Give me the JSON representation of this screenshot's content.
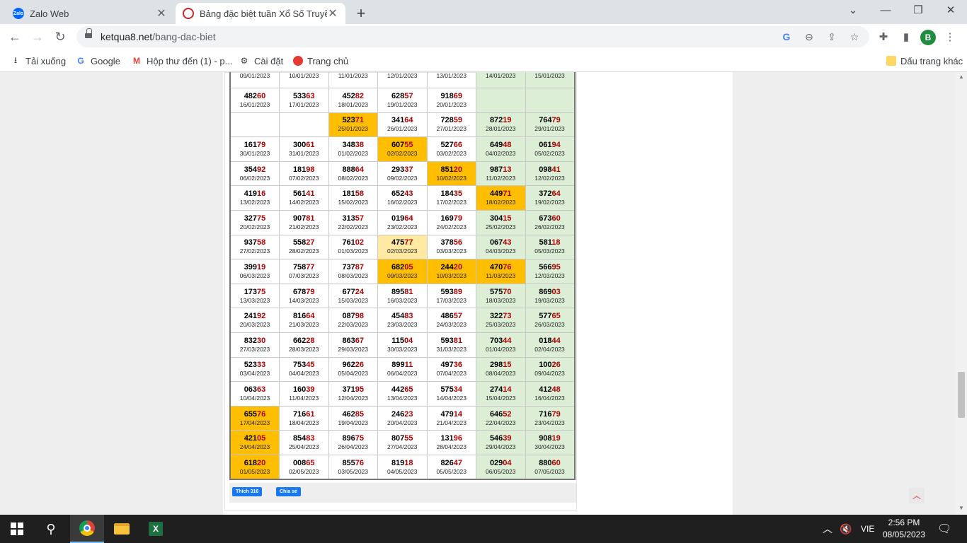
{
  "browser": {
    "tabs": [
      {
        "title": "Zalo Web",
        "favicon": "Zalo"
      },
      {
        "title": "Bảng đặc biệt tuần Xổ Số Truyền",
        "favicon": ""
      }
    ],
    "url_host": "ketqua8.net",
    "url_path": "/bang-dac-biet",
    "avatar_letter": "B",
    "bookmarks": [
      {
        "label": "Tải xuống",
        "icon": "download-icon"
      },
      {
        "label": "Google",
        "icon": "google-icon"
      },
      {
        "label": "Hộp thư đến (1) - p...",
        "icon": "gmail-icon"
      },
      {
        "label": "Cài đặt",
        "icon": "gear-icon"
      },
      {
        "label": "Trang chủ",
        "icon": "home-site-icon"
      }
    ],
    "other_bookmarks": "Dấu trang khác"
  },
  "table": {
    "rows": [
      [
        {
          "num": "",
          "date": "09/01/2023",
          "type": "normal"
        },
        {
          "num": "",
          "date": "10/01/2023",
          "type": "normal"
        },
        {
          "num": "",
          "date": "11/01/2023",
          "type": "normal"
        },
        {
          "num": "",
          "date": "12/01/2023",
          "type": "normal"
        },
        {
          "num": "",
          "date": "13/01/2023",
          "type": "normal"
        },
        {
          "num": "",
          "date": "14/01/2023",
          "type": "weekend"
        },
        {
          "num": "",
          "date": "15/01/2023",
          "type": "weekend"
        }
      ],
      [
        {
          "num": "48260",
          "date": "16/01/2023",
          "type": "normal"
        },
        {
          "num": "53363",
          "date": "17/01/2023",
          "type": "normal"
        },
        {
          "num": "45282",
          "date": "18/01/2023",
          "type": "normal"
        },
        {
          "num": "62857",
          "date": "19/01/2023",
          "type": "normal"
        },
        {
          "num": "91869",
          "date": "20/01/2023",
          "type": "normal"
        },
        {
          "num": "",
          "date": "",
          "type": "weekend"
        },
        {
          "num": "",
          "date": "",
          "type": "weekend"
        }
      ],
      [
        {
          "num": "",
          "date": "",
          "type": "normal"
        },
        {
          "num": "",
          "date": "",
          "type": "normal"
        },
        {
          "num": "52371",
          "date": "25/01/2023",
          "type": "hl"
        },
        {
          "num": "34164",
          "date": "26/01/2023",
          "type": "normal"
        },
        {
          "num": "72859",
          "date": "27/01/2023",
          "type": "normal"
        },
        {
          "num": "87219",
          "date": "28/01/2023",
          "type": "weekend"
        },
        {
          "num": "76479",
          "date": "29/01/2023",
          "type": "weekend"
        }
      ],
      [
        {
          "num": "16179",
          "date": "30/01/2023",
          "type": "normal"
        },
        {
          "num": "30061",
          "date": "31/01/2023",
          "type": "normal"
        },
        {
          "num": "34838",
          "date": "01/02/2023",
          "type": "normal"
        },
        {
          "num": "60755",
          "date": "02/02/2023",
          "type": "hl"
        },
        {
          "num": "52766",
          "date": "03/02/2023",
          "type": "normal"
        },
        {
          "num": "64948",
          "date": "04/02/2023",
          "type": "weekend"
        },
        {
          "num": "06194",
          "date": "05/02/2023",
          "type": "weekend"
        }
      ],
      [
        {
          "num": "35492",
          "date": "06/02/2023",
          "type": "normal"
        },
        {
          "num": "18198",
          "date": "07/02/2023",
          "type": "normal"
        },
        {
          "num": "88864",
          "date": "08/02/2023",
          "type": "normal"
        },
        {
          "num": "29337",
          "date": "09/02/2023",
          "type": "normal"
        },
        {
          "num": "85120",
          "date": "10/02/2023",
          "type": "hl"
        },
        {
          "num": "98713",
          "date": "11/02/2023",
          "type": "weekend"
        },
        {
          "num": "09841",
          "date": "12/02/2023",
          "type": "weekend"
        }
      ],
      [
        {
          "num": "41916",
          "date": "13/02/2023",
          "type": "normal"
        },
        {
          "num": "56141",
          "date": "14/02/2023",
          "type": "normal"
        },
        {
          "num": "18158",
          "date": "15/02/2023",
          "type": "normal"
        },
        {
          "num": "65243",
          "date": "16/02/2023",
          "type": "normal"
        },
        {
          "num": "18435",
          "date": "17/02/2023",
          "type": "normal"
        },
        {
          "num": "44971",
          "date": "18/02/2023",
          "type": "hl"
        },
        {
          "num": "37264",
          "date": "19/02/2023",
          "type": "weekend"
        }
      ],
      [
        {
          "num": "32775",
          "date": "20/02/2023",
          "type": "normal"
        },
        {
          "num": "90781",
          "date": "21/02/2023",
          "type": "normal"
        },
        {
          "num": "31357",
          "date": "22/02/2023",
          "type": "normal"
        },
        {
          "num": "01964",
          "date": "23/02/2023",
          "type": "normal"
        },
        {
          "num": "16979",
          "date": "24/02/2023",
          "type": "normal"
        },
        {
          "num": "30415",
          "date": "25/02/2023",
          "type": "weekend"
        },
        {
          "num": "67360",
          "date": "26/02/2023",
          "type": "weekend"
        }
      ],
      [
        {
          "num": "93758",
          "date": "27/02/2023",
          "type": "normal"
        },
        {
          "num": "55827",
          "date": "28/02/2023",
          "type": "normal"
        },
        {
          "num": "76102",
          "date": "01/03/2023",
          "type": "normal"
        },
        {
          "num": "47577",
          "date": "02/03/2023",
          "type": "lt"
        },
        {
          "num": "37856",
          "date": "03/03/2023",
          "type": "normal"
        },
        {
          "num": "06743",
          "date": "04/03/2023",
          "type": "weekend"
        },
        {
          "num": "58118",
          "date": "05/03/2023",
          "type": "weekend"
        }
      ],
      [
        {
          "num": "39919",
          "date": "06/03/2023",
          "type": "normal"
        },
        {
          "num": "75877",
          "date": "07/03/2023",
          "type": "normal"
        },
        {
          "num": "73787",
          "date": "08/03/2023",
          "type": "normal"
        },
        {
          "num": "68205",
          "date": "09/03/2023",
          "type": "hl"
        },
        {
          "num": "24420",
          "date": "10/03/2023",
          "type": "hl"
        },
        {
          "num": "47076",
          "date": "11/03/2023",
          "type": "hl"
        },
        {
          "num": "56695",
          "date": "12/03/2023",
          "type": "weekend"
        }
      ],
      [
        {
          "num": "17375",
          "date": "13/03/2023",
          "type": "normal"
        },
        {
          "num": "67879",
          "date": "14/03/2023",
          "type": "normal"
        },
        {
          "num": "67724",
          "date": "15/03/2023",
          "type": "normal"
        },
        {
          "num": "89581",
          "date": "16/03/2023",
          "type": "normal"
        },
        {
          "num": "59389",
          "date": "17/03/2023",
          "type": "normal"
        },
        {
          "num": "57570",
          "date": "18/03/2023",
          "type": "weekend"
        },
        {
          "num": "86903",
          "date": "19/03/2023",
          "type": "weekend"
        }
      ],
      [
        {
          "num": "24192",
          "date": "20/03/2023",
          "type": "normal"
        },
        {
          "num": "81664",
          "date": "21/03/2023",
          "type": "normal"
        },
        {
          "num": "08798",
          "date": "22/03/2023",
          "type": "normal"
        },
        {
          "num": "45483",
          "date": "23/03/2023",
          "type": "normal"
        },
        {
          "num": "48657",
          "date": "24/03/2023",
          "type": "normal"
        },
        {
          "num": "32273",
          "date": "25/03/2023",
          "type": "weekend"
        },
        {
          "num": "57765",
          "date": "26/03/2023",
          "type": "weekend"
        }
      ],
      [
        {
          "num": "83230",
          "date": "27/03/2023",
          "type": "normal"
        },
        {
          "num": "66228",
          "date": "28/03/2023",
          "type": "normal"
        },
        {
          "num": "86367",
          "date": "29/03/2023",
          "type": "normal"
        },
        {
          "num": "11504",
          "date": "30/03/2023",
          "type": "normal"
        },
        {
          "num": "59381",
          "date": "31/03/2023",
          "type": "normal"
        },
        {
          "num": "70344",
          "date": "01/04/2023",
          "type": "weekend"
        },
        {
          "num": "01844",
          "date": "02/04/2023",
          "type": "weekend"
        }
      ],
      [
        {
          "num": "52333",
          "date": "03/04/2023",
          "type": "normal"
        },
        {
          "num": "75345",
          "date": "04/04/2023",
          "type": "normal"
        },
        {
          "num": "96226",
          "date": "05/04/2023",
          "type": "normal"
        },
        {
          "num": "89911",
          "date": "06/04/2023",
          "type": "normal"
        },
        {
          "num": "49736",
          "date": "07/04/2023",
          "type": "normal"
        },
        {
          "num": "29815",
          "date": "08/04/2023",
          "type": "weekend"
        },
        {
          "num": "10026",
          "date": "09/04/2023",
          "type": "weekend"
        }
      ],
      [
        {
          "num": "06363",
          "date": "10/04/2023",
          "type": "normal"
        },
        {
          "num": "16039",
          "date": "11/04/2023",
          "type": "normal"
        },
        {
          "num": "37195",
          "date": "12/04/2023",
          "type": "normal"
        },
        {
          "num": "44265",
          "date": "13/04/2023",
          "type": "normal"
        },
        {
          "num": "57534",
          "date": "14/04/2023",
          "type": "normal"
        },
        {
          "num": "27414",
          "date": "15/04/2023",
          "type": "weekend"
        },
        {
          "num": "41248",
          "date": "16/04/2023",
          "type": "weekend"
        }
      ],
      [
        {
          "num": "65576",
          "date": "17/04/2023",
          "type": "hl"
        },
        {
          "num": "71661",
          "date": "18/04/2023",
          "type": "normal"
        },
        {
          "num": "46285",
          "date": "19/04/2023",
          "type": "normal"
        },
        {
          "num": "24623",
          "date": "20/04/2023",
          "type": "normal"
        },
        {
          "num": "47914",
          "date": "21/04/2023",
          "type": "normal"
        },
        {
          "num": "64652",
          "date": "22/04/2023",
          "type": "weekend"
        },
        {
          "num": "71679",
          "date": "23/04/2023",
          "type": "weekend"
        }
      ],
      [
        {
          "num": "42105",
          "date": "24/04/2023",
          "type": "hl"
        },
        {
          "num": "85483",
          "date": "25/04/2023",
          "type": "normal"
        },
        {
          "num": "89675",
          "date": "26/04/2023",
          "type": "normal"
        },
        {
          "num": "80755",
          "date": "27/04/2023",
          "type": "normal"
        },
        {
          "num": "13196",
          "date": "28/04/2023",
          "type": "normal"
        },
        {
          "num": "54639",
          "date": "29/04/2023",
          "type": "weekend"
        },
        {
          "num": "90819",
          "date": "30/04/2023",
          "type": "weekend"
        }
      ],
      [
        {
          "num": "61820",
          "date": "01/05/2023",
          "type": "hl"
        },
        {
          "num": "00865",
          "date": "02/05/2023",
          "type": "normal"
        },
        {
          "num": "85576",
          "date": "03/05/2023",
          "type": "normal"
        },
        {
          "num": "81918",
          "date": "04/05/2023",
          "type": "normal"
        },
        {
          "num": "82647",
          "date": "05/05/2023",
          "type": "normal"
        },
        {
          "num": "02904",
          "date": "06/05/2023",
          "type": "weekend"
        },
        {
          "num": "88060",
          "date": "07/05/2023",
          "type": "weekend"
        }
      ]
    ]
  },
  "social": {
    "like_label": "Thích 316",
    "share_label": "Chia sẻ"
  },
  "taskbar": {
    "lang": "VIE",
    "time": "2:56 PM",
    "date": "08/05/2023",
    "excel_letter": "X"
  },
  "colors": {
    "highlight": "#ffbf00",
    "light_highlight": "#ffe9a3",
    "weekend": "#dcefd6",
    "tail_digits": "#b00000"
  }
}
